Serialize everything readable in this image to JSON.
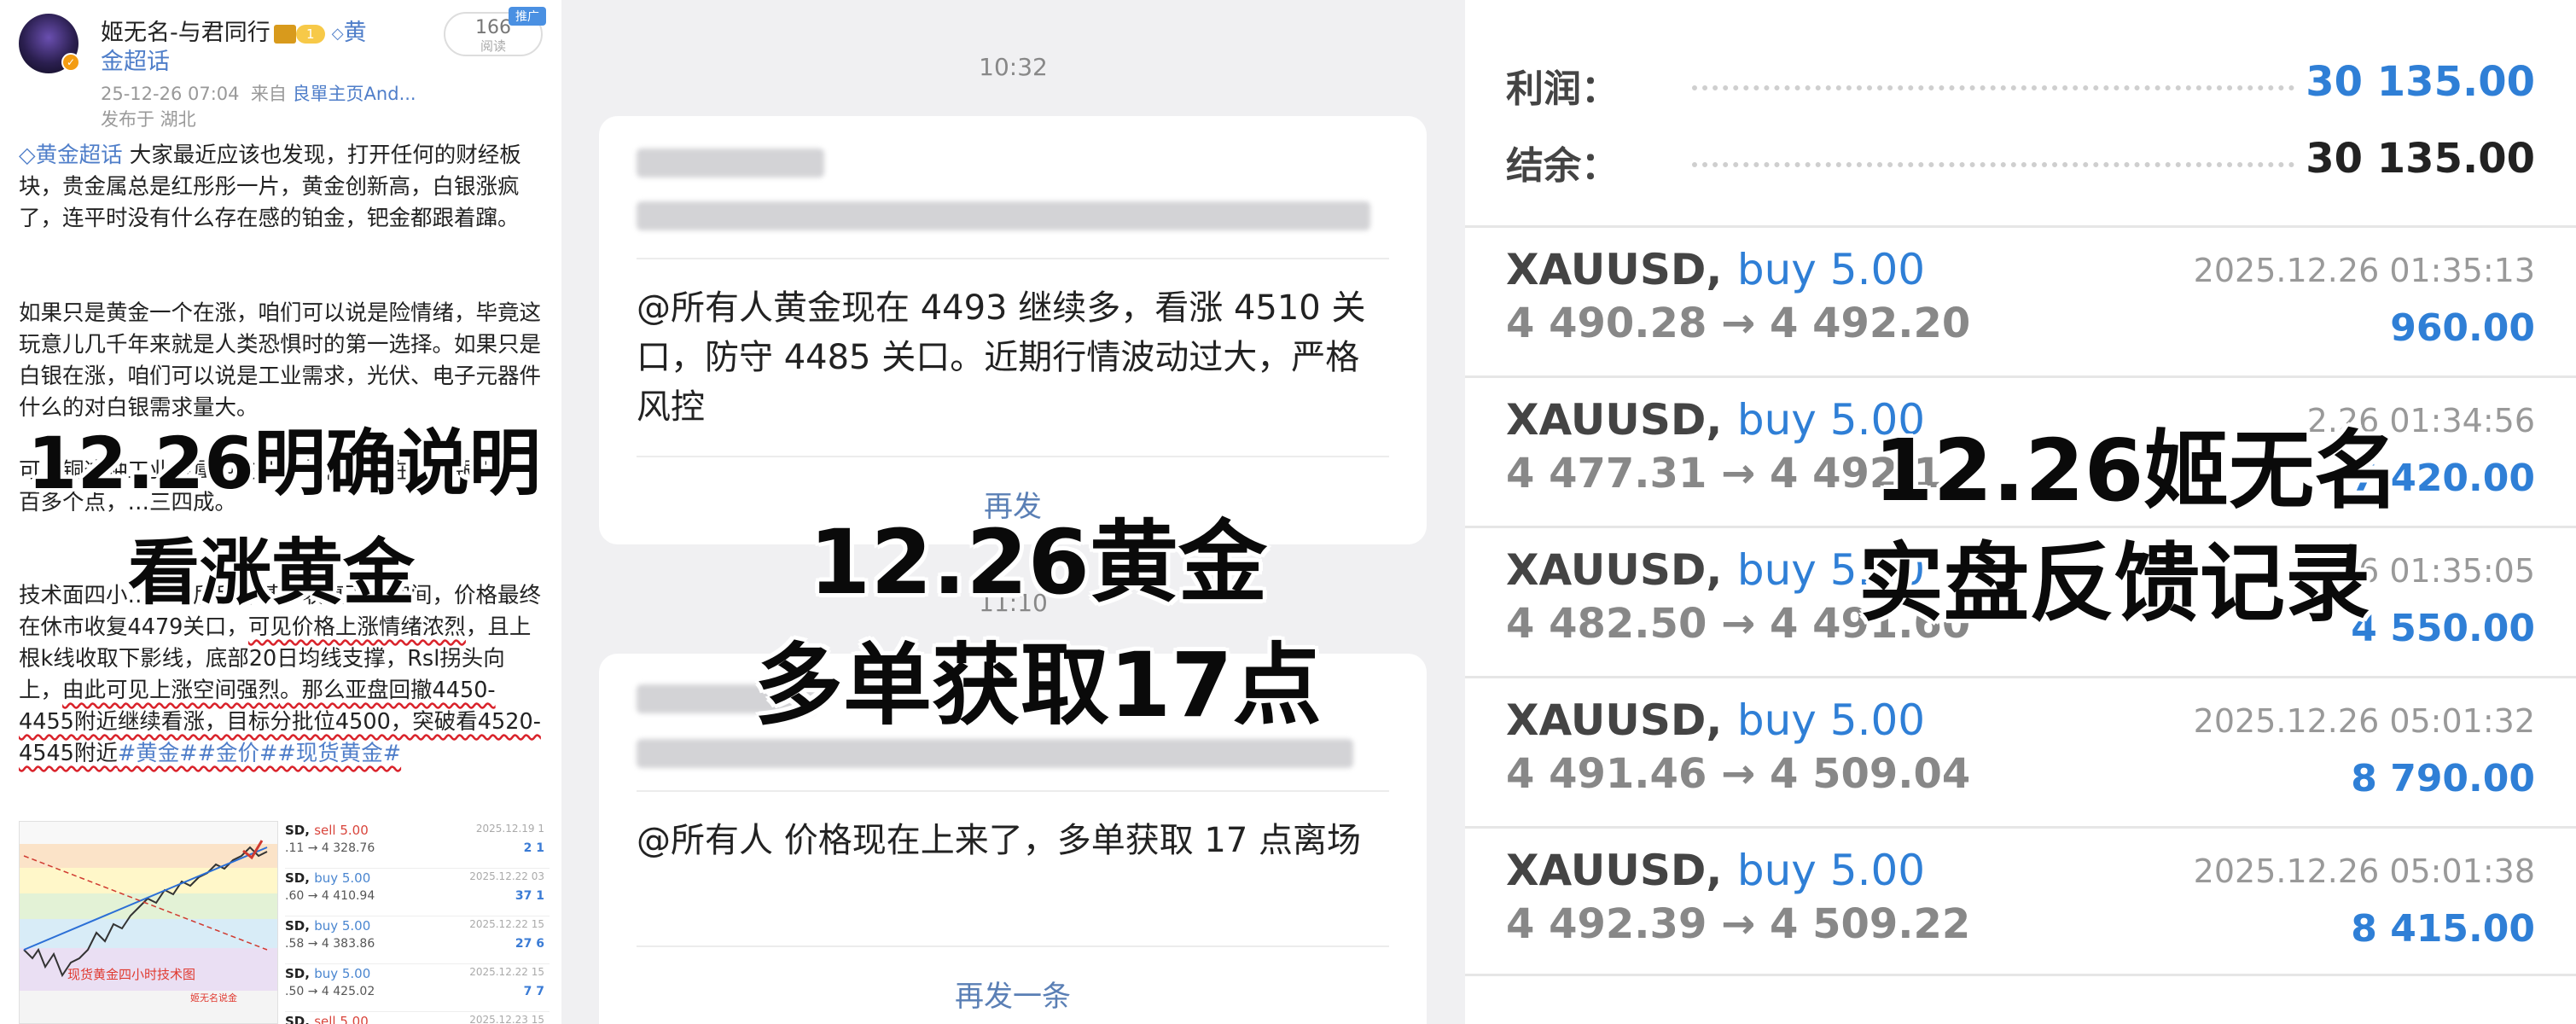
{
  "weibo": {
    "author": "姬无名-与君同行",
    "vip_level": "1",
    "topic_line1": "黄",
    "topic_line2": "金超话",
    "read_count": "166",
    "read_label": "阅读",
    "promo": "推广",
    "time": "25-12-26 07:04",
    "source_prefix": "来自",
    "source": "良單主页And...",
    "location": "发布于 湖北",
    "p1_topic": "黄金超话",
    "p1_text": " 大家最近应该也发现，打开任何的财经板块，贵金属总是红彤彤一片，黄金创新高，白银涨疯了，连平时没有什么存在感的铂金，钯金都跟着蹿。",
    "p2": "如果只是黄金一个在涨，咱们可以说是险情绪，毕竟这玩意儿几千年来就是人类恐惧时的第一选择。如果只是白银在涨，咱们可以说是工业需求，光伏、电子元器件什么的对白银需求量大。",
    "p3": "可…铜这种工业金属也在涨。年初到现在，白银涨了一百多个点，…三四成。",
    "p4a": "技术面四小…撤然后反弹基本收复下跌空间，价格最终在休市收复4479关口，",
    "p4b_red": "可见价格上涨情绪浓烈",
    "p4c": "，且上根k线收取下影线，底部20日均线支撑，Rsl拐头向上，",
    "p4d_red": "由此可见上涨空间强烈",
    "p4e": "。那么亚盘回撤4450-4455附近继续看涨，目标分批位4500，突破看4520-4545附近",
    "p4_tags": "#黄金##金价##现货黄金#",
    "chart_caption": "现货黄金四小时技术图",
    "chart_brand": "姬无名说金",
    "mini_trades": [
      {
        "sym": "SD,",
        "side": "sell 5.00",
        "type": "sell",
        "price": ".11 → 4 328.76",
        "date": "2025.12.19 1",
        "pl": "2 1"
      },
      {
        "sym": "SD,",
        "side": "buy 5.00",
        "type": "buy",
        "price": ".60 → 4 410.94",
        "date": "2025.12.22 03",
        "pl": "37 1"
      },
      {
        "sym": "SD,",
        "side": "buy 5.00",
        "type": "buy",
        "price": ".58 → 4 383.86",
        "date": "2025.12.22 15",
        "pl": "27 6"
      },
      {
        "sym": "SD,",
        "side": "buy 5.00",
        "type": "buy",
        "price": ".50 → 4 425.02",
        "date": "2025.12.22 15",
        "pl": "7 7"
      },
      {
        "sym": "SD,",
        "side": "sell 5.00",
        "type": "sell",
        "price": "",
        "date": "2025.12.23 15",
        "pl": ""
      }
    ]
  },
  "chat": {
    "time1": "10:32",
    "msg1": "@所有人黄金现在 4493 继续多，看涨 4510 关口，防守 4485 关口。近期行情波动过大，严格风控",
    "resend_partial": "再发",
    "time2": "11:10",
    "msg2": "@所有人 价格现在上来了，多单获取 17 点离场",
    "resend": "再发一条"
  },
  "trades": {
    "summary": [
      {
        "label": "利润：",
        "value": "30 135.00",
        "accent": true
      },
      {
        "label": "结余：",
        "value": "30 135.00",
        "accent": false
      }
    ],
    "rows": [
      {
        "symbol": "XAUUSD,",
        "side": "buy 5.00",
        "prices": "4 490.28 → 4 492.20",
        "date": "2025.12.26 01:35:13",
        "profit": "960.00"
      },
      {
        "symbol": "XAUUSD,",
        "side": "buy 5.00",
        "prices": "4 477.31 → 4 492.1",
        "date": "2.26 01:34:56",
        "profit": "7 420.00"
      },
      {
        "symbol": "XAUUSD,",
        "side": "buy 5.00",
        "prices": "4 482.50 → 4 491.60",
        "date": "2.26 01:35:05",
        "profit": "4 550.00"
      },
      {
        "symbol": "XAUUSD,",
        "side": "buy 5.00",
        "prices": "4 491.46 → 4 509.04",
        "date": "2025.12.26 05:01:32",
        "profit": "8 790.00"
      },
      {
        "symbol": "XAUUSD,",
        "side": "buy 5.00",
        "prices": "4 492.39 → 4 509.22",
        "date": "2025.12.26 05:01:38",
        "profit": "8 415.00"
      }
    ]
  },
  "overlays": {
    "left1": "12.26明确说明",
    "left2": "看涨黄金",
    "mid1": "12.26黄金",
    "mid2": "多单获取17点",
    "right1": "12.26姬无名",
    "right2": "实盘反馈记录"
  },
  "colors": {
    "accent_blue": "#2f7fd6",
    "link_blue": "#4f7ec9",
    "underline_red": "#d9232b",
    "chat_bg": "#f0f0f2"
  }
}
